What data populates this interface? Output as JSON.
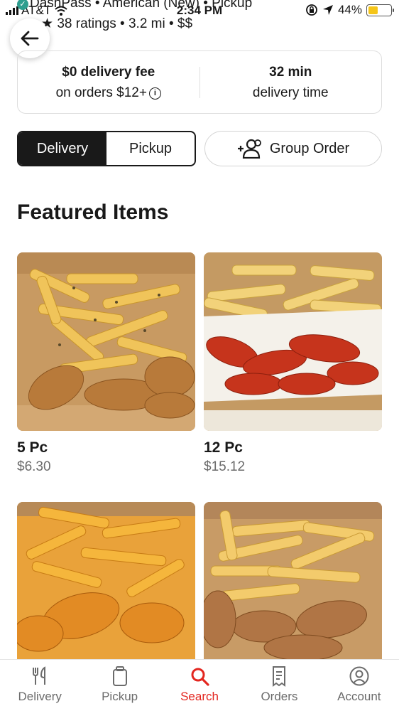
{
  "status_bar": {
    "carrier": "AT&T",
    "time": "2:34 PM",
    "battery_percent": "44%",
    "battery_level": 0.44
  },
  "store": {
    "meta_line_1": "DashPass • American (New) • Pickup",
    "meta_line_2": "38 ratings • 3.2 mi • $$"
  },
  "delivery_info": {
    "fee_value": "$0",
    "fee_label": "delivery fee",
    "fee_condition": "on orders $12+",
    "time_value": "32 min",
    "time_label": "delivery time"
  },
  "mode_toggle": {
    "delivery": "Delivery",
    "pickup": "Pickup",
    "selected": "Delivery"
  },
  "group_order_label": "Group Order",
  "featured": {
    "title": "Featured Items",
    "items": [
      {
        "name": "5 Pc",
        "price": "$6.30"
      },
      {
        "name": "12 Pc",
        "price": "$15.12"
      },
      {
        "name": "",
        "price": ""
      },
      {
        "name": "",
        "price": ""
      }
    ]
  },
  "bottom_nav": {
    "items": [
      {
        "label": "Delivery",
        "icon": "fork-knife-icon"
      },
      {
        "label": "Pickup",
        "icon": "bag-icon"
      },
      {
        "label": "Search",
        "icon": "search-icon"
      },
      {
        "label": "Orders",
        "icon": "receipt-icon"
      },
      {
        "label": "Account",
        "icon": "account-icon"
      }
    ],
    "active": "Search"
  },
  "colors": {
    "accent": "#e3261f",
    "dashpass": "#2f9e8f",
    "toggle_active": "#191919"
  }
}
